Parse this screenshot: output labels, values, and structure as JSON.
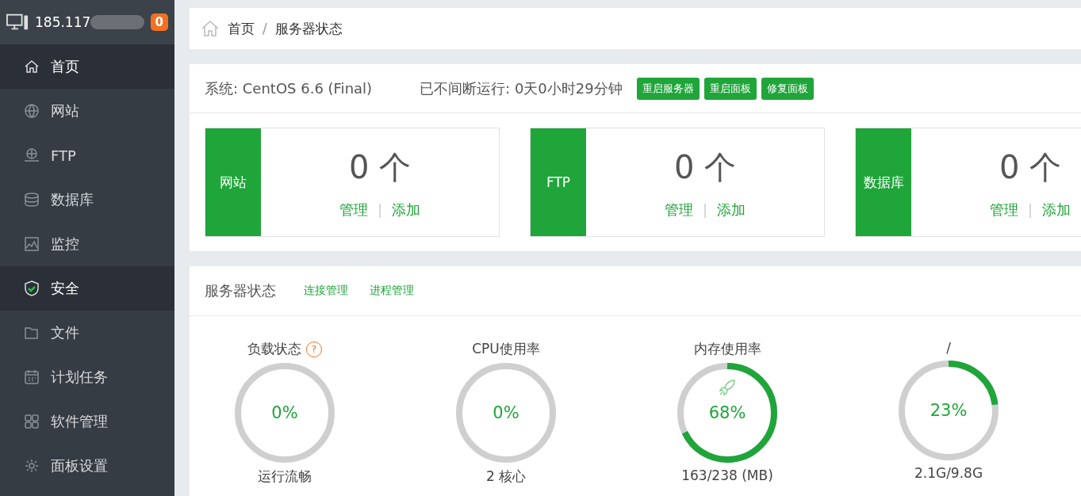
{
  "sidebar": {
    "host": "185.117",
    "host_redacted": true,
    "badge": "0",
    "items": [
      {
        "label": "首页",
        "selected": true
      },
      {
        "label": "网站",
        "selected": false
      },
      {
        "label": "FTP",
        "selected": false
      },
      {
        "label": "数据库",
        "selected": false
      },
      {
        "label": "监控",
        "selected": false
      },
      {
        "label": "安全",
        "selected": true
      },
      {
        "label": "文件",
        "selected": false
      },
      {
        "label": "计划任务",
        "selected": false
      },
      {
        "label": "软件管理",
        "selected": false
      },
      {
        "label": "面板设置",
        "selected": false
      }
    ]
  },
  "breadcrumb": {
    "items": [
      "首页",
      "服务器状态"
    ],
    "separator": "/"
  },
  "system": {
    "os": "系统: CentOS 6.6 (Final)",
    "uptime": "已不间断运行: 0天0小时29分钟",
    "buttons": [
      "重启服务器",
      "重启面板",
      "修复面板"
    ]
  },
  "stats": [
    {
      "label": "网站",
      "count": "0 个",
      "links": [
        "管理",
        "添加"
      ],
      "separator": "|"
    },
    {
      "label": "FTP",
      "count": "0 个",
      "links": [
        "管理",
        "添加"
      ],
      "separator": "|"
    },
    {
      "label": "数据库",
      "count": "0 个",
      "links": [
        "管理",
        "添加"
      ],
      "separator": "|"
    }
  ],
  "status": {
    "title": "服务器状态",
    "links": [
      "连接管理",
      "进程管理"
    ],
    "gauges": [
      {
        "title": "负载状态",
        "help": "?",
        "level": 0,
        "reading": "0%",
        "caption": "运行流畅"
      },
      {
        "title": "CPU使用率",
        "level": 0,
        "reading": "0%",
        "caption": "2 核心"
      },
      {
        "title": "内存使用率",
        "rocket": true,
        "level": 0.68,
        "reading": "68%",
        "caption": "163/238 (MB)"
      },
      {
        "title": "/",
        "level": 0.23,
        "reading": "23%",
        "caption": "2.1G/9.8G"
      }
    ]
  }
}
